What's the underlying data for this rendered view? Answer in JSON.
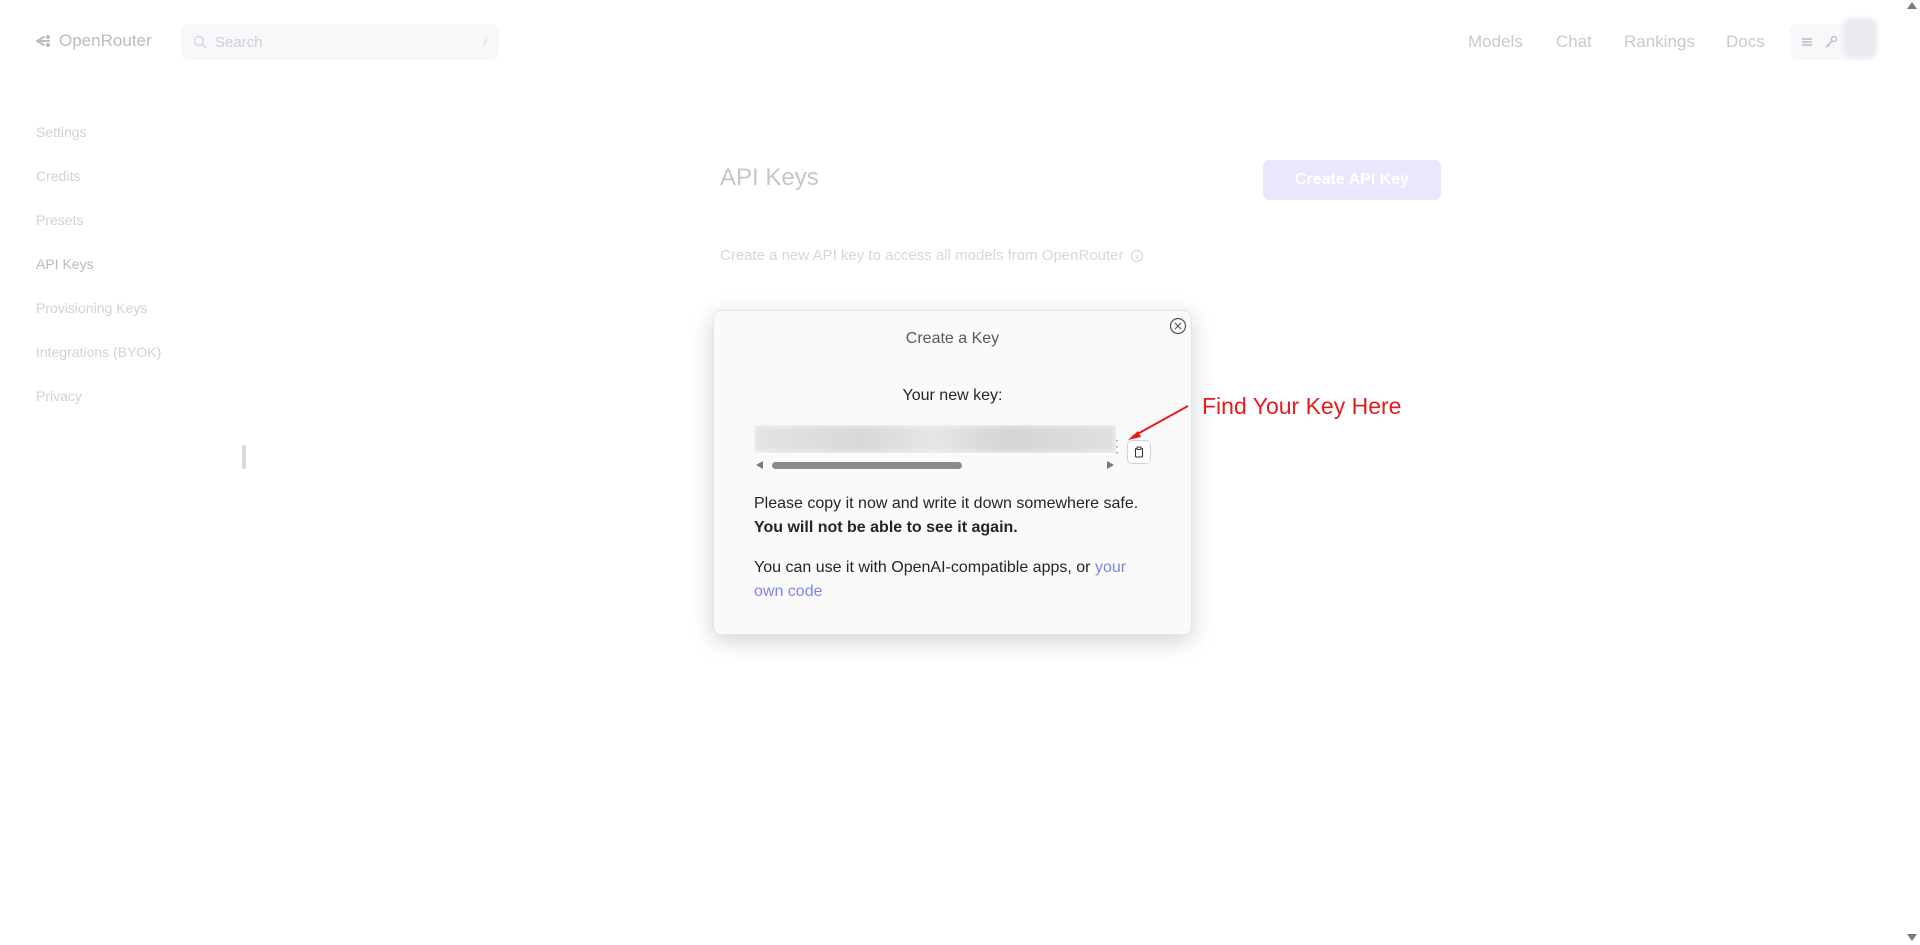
{
  "header": {
    "logo_text": "OpenRouter",
    "search_placeholder": "Search",
    "search_shortcut": "/",
    "nav": [
      "Models",
      "Chat",
      "Rankings",
      "Docs"
    ]
  },
  "sidebar": {
    "items": [
      {
        "label": "Settings",
        "active": false
      },
      {
        "label": "Credits",
        "active": false
      },
      {
        "label": "Presets",
        "active": false
      },
      {
        "label": "API Keys",
        "active": true
      },
      {
        "label": "Provisioning Keys",
        "active": false
      },
      {
        "label": "Integrations (BYOK)",
        "active": false
      },
      {
        "label": "Privacy",
        "active": false
      }
    ]
  },
  "main": {
    "title": "API Keys",
    "create_button": "Create API Key",
    "description": "Create a new API key to access all models from OpenRouter"
  },
  "modal": {
    "title": "Create a Key",
    "key_label": "Your new key:",
    "warning_text": "Please copy it now and write it down somewhere safe. ",
    "warning_bold": "You will not be able to see it again.",
    "usage_text": "You can use it with OpenAI-compatible apps, or ",
    "usage_link": "your own code"
  },
  "annotation": {
    "text": "Find Your Key Here",
    "color": "#e41b1b"
  },
  "colors": {
    "accent": "#7f86e6",
    "button_bg": "#e9e7fd"
  }
}
